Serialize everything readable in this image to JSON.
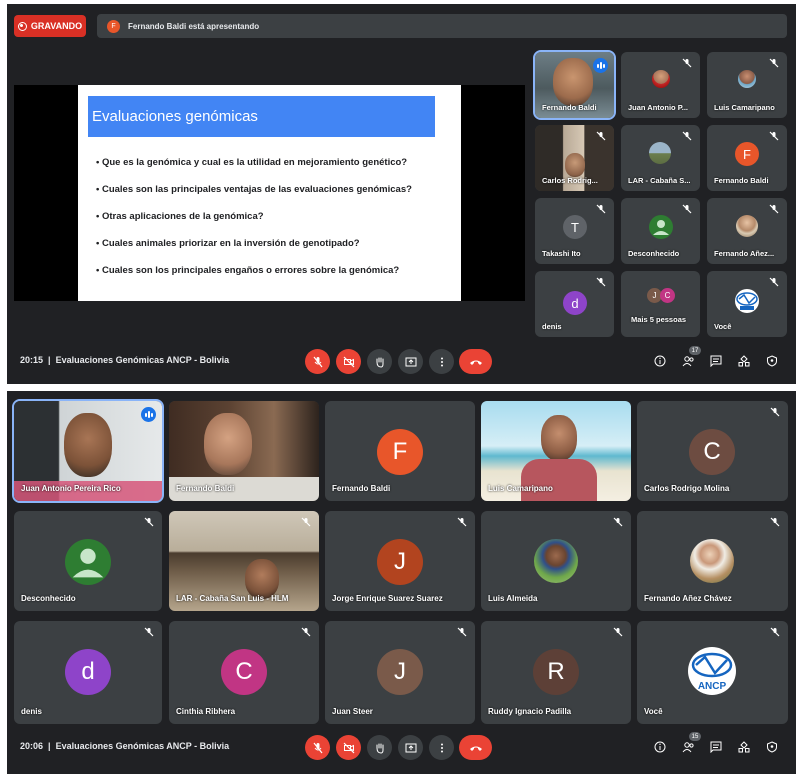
{
  "top": {
    "recording_label": "GRAVANDO",
    "presenter_initial": "F",
    "presenter_banner": "Fernando Baldi está apresentando",
    "slide": {
      "title": "Evaluaciones genómicas",
      "bullets": [
        "Que es la genómica y cual es la utilidad en mejoramiento genético?",
        "Cuales son las principales ventajas de las evaluaciones genómicas?",
        "Otras aplicaciones de la genómica?",
        "Cuales animales priorizar en la inversión de genotipado?",
        "Cuales son los principales engaños o errores sobre la genómica?"
      ]
    },
    "tiles": [
      {
        "name": "Fernando Baldi"
      },
      {
        "name": "Juan Antonio P..."
      },
      {
        "name": "Luis Camaripano"
      },
      {
        "name": "Carlos Rodrig..."
      },
      {
        "name": "LAR - Cabaña S..."
      },
      {
        "name": "Fernando Baldi",
        "initial": "F"
      },
      {
        "name": "Takashi Ito",
        "initial": "T"
      },
      {
        "name": "Desconhecido"
      },
      {
        "name": "Fernando Añez..."
      },
      {
        "name": "denis",
        "initial": "d"
      },
      {
        "name": "Mais 5 pessoas",
        "initials": [
          "J",
          "C"
        ]
      },
      {
        "name": "Você"
      }
    ],
    "bar": {
      "time": "20:15",
      "meeting": "Evaluaciones Genómicas ANCP - Bolivia",
      "participants": "17"
    }
  },
  "bottom": {
    "tiles": [
      {
        "name": "Juan Antonio Pereira Rico"
      },
      {
        "name": "Fernando Baldi"
      },
      {
        "name": "Fernando Baldi",
        "initial": "F"
      },
      {
        "name": "Luis Camaripano"
      },
      {
        "name": "Carlos Rodrigo Molina",
        "initial": "C"
      },
      {
        "name": "Desconhecido"
      },
      {
        "name": "LAR - Cabaña San Luis - HLM"
      },
      {
        "name": "Jorge Enrique Suarez Suarez",
        "initial": "J"
      },
      {
        "name": "Luis Almeida"
      },
      {
        "name": "Fernando Añez Chávez"
      },
      {
        "name": "denis",
        "initial": "d"
      },
      {
        "name": "Cinthia Ribhera",
        "initial": "C"
      },
      {
        "name": "Juan Steer",
        "initial": "J"
      },
      {
        "name": "Ruddy Ignacio Padilla",
        "initial": "R"
      },
      {
        "name": "Você"
      }
    ],
    "bar": {
      "time": "20:06",
      "meeting": "Evaluaciones Genómicas ANCP - Bolivia",
      "participants": "15"
    }
  },
  "logo_text": "ANCP",
  "colors": {
    "background": "#202124",
    "tile": "#3c4043",
    "accent": "#8ab4f8",
    "danger": "#ea4335",
    "avatar_orange": "#e8562a",
    "avatar_purple": "#8e44c9",
    "avatar_pink": "#c13584",
    "avatar_brown": "#7a5a4a",
    "avatar_darkred": "#8a3f35",
    "avatar_gray": "#5f6368",
    "avatar_green": "#2e7d32"
  },
  "icons": [
    "record-icon",
    "mic-off-icon",
    "camera-off-icon",
    "raise-hand-icon",
    "present-icon",
    "more-icon",
    "end-call-icon",
    "info-icon",
    "people-icon",
    "chat-icon",
    "activities-icon",
    "shield-icon",
    "speaking-icon"
  ]
}
